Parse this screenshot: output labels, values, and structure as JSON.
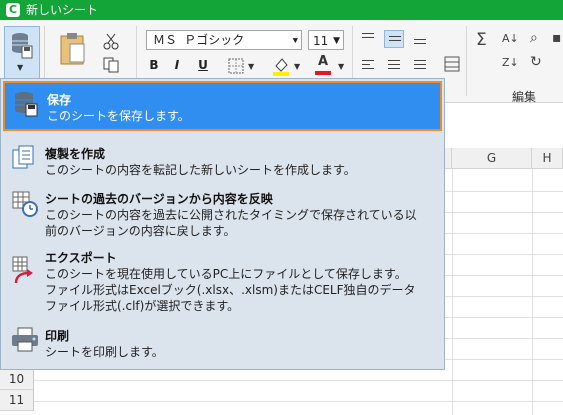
{
  "titlebar": {
    "logo": "C",
    "title": "新しいシート"
  },
  "ribbon": {
    "font_name": "ＭＳ Ｐゴシック",
    "font_size": "11",
    "bold": "B",
    "italic": "I",
    "underline": "U",
    "font_color_letter": "A",
    "edit_group_label": "編集",
    "sum_symbol": "Σ"
  },
  "grid": {
    "columns": [
      "G",
      "H"
    ],
    "rows": [
      "10",
      "11"
    ]
  },
  "menu": {
    "items": [
      {
        "title": "保存",
        "desc": [
          "このシートを保存します。"
        ],
        "icon": "save-icon"
      },
      {
        "title": "複製を作成",
        "desc": [
          "このシートの内容を転記した新しいシートを作成します。"
        ],
        "icon": "duplicate-icon"
      },
      {
        "title": "シートの過去のバージョンから内容を反映",
        "desc": [
          "このシートの内容を過去に公開されたタイミングで保存されている以",
          "前のバージョンの内容に戻します。"
        ],
        "icon": "version-history-icon"
      },
      {
        "title": "エクスポート",
        "desc": [
          "このシートを現在使用しているPC上にファイルとして保存します。",
          "ファイル形式はExcelブック(.xlsx、.xlsm)またはCELF独自のデータ",
          "ファイル形式(.clf)が選択できます。"
        ],
        "icon": "export-icon"
      },
      {
        "title": "印刷",
        "desc": [
          "シートを印刷します。"
        ],
        "icon": "print-icon"
      }
    ]
  },
  "colors": {
    "titlebar": "#13a538",
    "menu_bg": "#dbe3ec",
    "selected": "#2f8ef0",
    "selected_border": "#f08a24"
  }
}
